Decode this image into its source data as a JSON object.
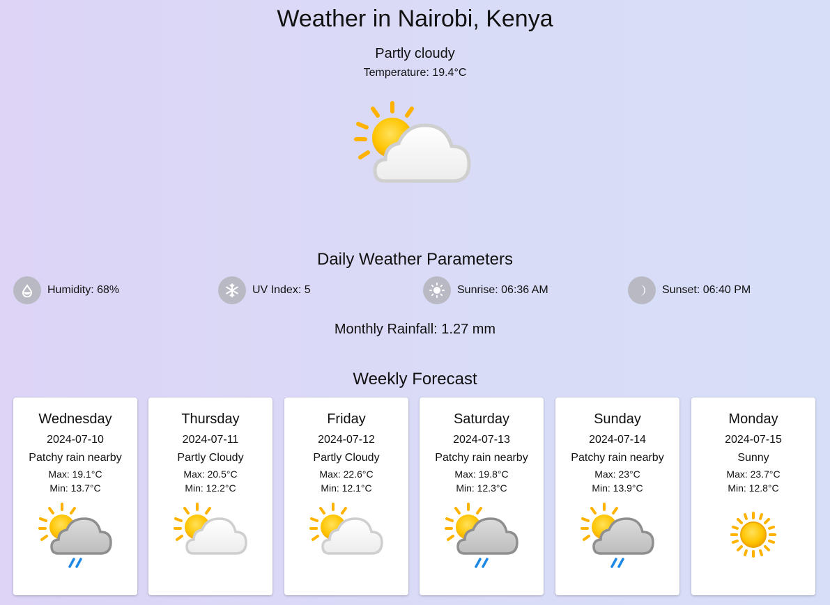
{
  "header": {
    "title": "Weather in Nairobi, Kenya",
    "condition": "Partly cloudy",
    "temperature": "Temperature: 19.4°C",
    "icon": "partly-cloudy-icon"
  },
  "daily": {
    "title": "Daily Weather Parameters",
    "items": [
      {
        "label": "Humidity: 68%",
        "icon": "humidity-drop-icon"
      },
      {
        "label": "UV Index: 5",
        "icon": "uv-snowflake-icon"
      },
      {
        "label": "Sunrise: 06:36 AM",
        "icon": "sunrise-sun-icon"
      },
      {
        "label": "Sunset: 06:40 PM",
        "icon": "sunset-moon-icon"
      }
    ],
    "rainfall": "Monthly Rainfall: 1.27 mm"
  },
  "forecast": {
    "title": "Weekly Forecast",
    "days": [
      {
        "day": "Wednesday",
        "date": "2024-07-10",
        "condition": "Patchy rain nearby",
        "max": "Max: 19.1°C",
        "min": "Min: 13.7°C",
        "icon": "patchy-rain-icon"
      },
      {
        "day": "Thursday",
        "date": "2024-07-11",
        "condition": "Partly Cloudy",
        "max": "Max: 20.5°C",
        "min": "Min: 12.2°C",
        "icon": "partly-cloudy-icon"
      },
      {
        "day": "Friday",
        "date": "2024-07-12",
        "condition": "Partly Cloudy",
        "max": "Max: 22.6°C",
        "min": "Min: 12.1°C",
        "icon": "partly-cloudy-icon"
      },
      {
        "day": "Saturday",
        "date": "2024-07-13",
        "condition": "Patchy rain nearby",
        "max": "Max: 19.8°C",
        "min": "Min: 12.3°C",
        "icon": "patchy-rain-icon"
      },
      {
        "day": "Sunday",
        "date": "2024-07-14",
        "condition": "Patchy rain nearby",
        "max": "Max: 23°C",
        "min": "Min: 13.9°C",
        "icon": "patchy-rain-icon"
      },
      {
        "day": "Monday",
        "date": "2024-07-15",
        "condition": "Sunny",
        "max": "Max: 23.7°C",
        "min": "Min: 12.8°C",
        "icon": "sunny-icon"
      }
    ]
  },
  "colors": {
    "sun": "#ffc107",
    "sun_ray": "#ffb300",
    "cloud_white": "#f5f5f5",
    "cloud_gray": "#cfcfcf",
    "rain": "#1e88e5",
    "badge": "#b9b9c4"
  }
}
